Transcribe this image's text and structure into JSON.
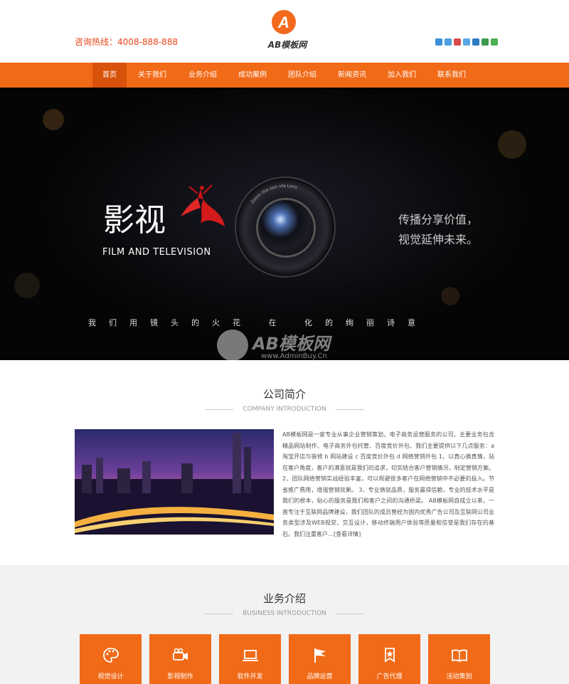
{
  "header": {
    "hotline": "咨询热线：4008-888-888",
    "logo_text": "AB模板网",
    "logo_mark": "A"
  },
  "nav": {
    "items": [
      "首页",
      "关于我们",
      "业务介绍",
      "成功案例",
      "团队介绍",
      "新闻资讯",
      "加入我们",
      "联系我们"
    ],
    "active_index": 0
  },
  "banner": {
    "title_cn": "影视",
    "title_en": "FILM AND TELEVISION",
    "slogan_line1": "传播分享价值，",
    "slogan_line2": "视觉延伸未来。",
    "poem": "我们用镜头的火花  在  化的绚丽诗意",
    "lens_text": "Zoom the oon xfa Lens",
    "watermark_title": "AB模板网",
    "watermark_url": "www.AdminBuy.Cn"
  },
  "company": {
    "title": "公司简介",
    "subtitle": "COMPANY INTRODUCTION",
    "text": "AB模板网是一家专业从事企业营销策划、电子商务运营服务的公司，主要业务包含精品网站制作、电子商务外包托管、百度竞价外包、我们主要提供以下几点服务：a 淘宝开店与装修 b 网站建设 c 百度竞价外包 d 网络营销外包 1、以真心换真情，站在客户角度，客户的满意就是我们的追求，切实结合客户营销情况，制定营销方案。 2、团队网络营销实战经验丰富，可以规避很多客户在网络营销中不必要的投入。节省推广费用，增强营销效果。 3、专业铸就品质，服务赢得信赖，专业的技术水平是我们的根本，贴心的服务是我们和客户之间的沟通桥梁。 AB模板网自成立以来，一直专注于互联网品牌建设，我们团队的成员曾经为国内优秀广告公司及互联网公司业务类型涉及WEB视觉、交互设计，移动终端用户体验等质量和信誉是我们存在的基石。我们注重客户…",
    "more": "[查看详情]"
  },
  "business": {
    "title": "业务介绍",
    "subtitle": "BUSINESS INTRODUCTION",
    "items": [
      {
        "label": "视觉设计",
        "icon": "palette-icon"
      },
      {
        "label": "影视制作",
        "icon": "video-camera-icon"
      },
      {
        "label": "软件开发",
        "icon": "laptop-icon"
      },
      {
        "label": "品牌运营",
        "icon": "flag-icon"
      },
      {
        "label": "广告代理",
        "icon": "badge-star-icon"
      },
      {
        "label": "活动策划",
        "icon": "open-book-icon"
      }
    ]
  },
  "colors": {
    "accent": "#f16a17",
    "accent_dark": "#d9520b",
    "hotline": "#e8451a",
    "business_bg": "#f2f2f2"
  }
}
